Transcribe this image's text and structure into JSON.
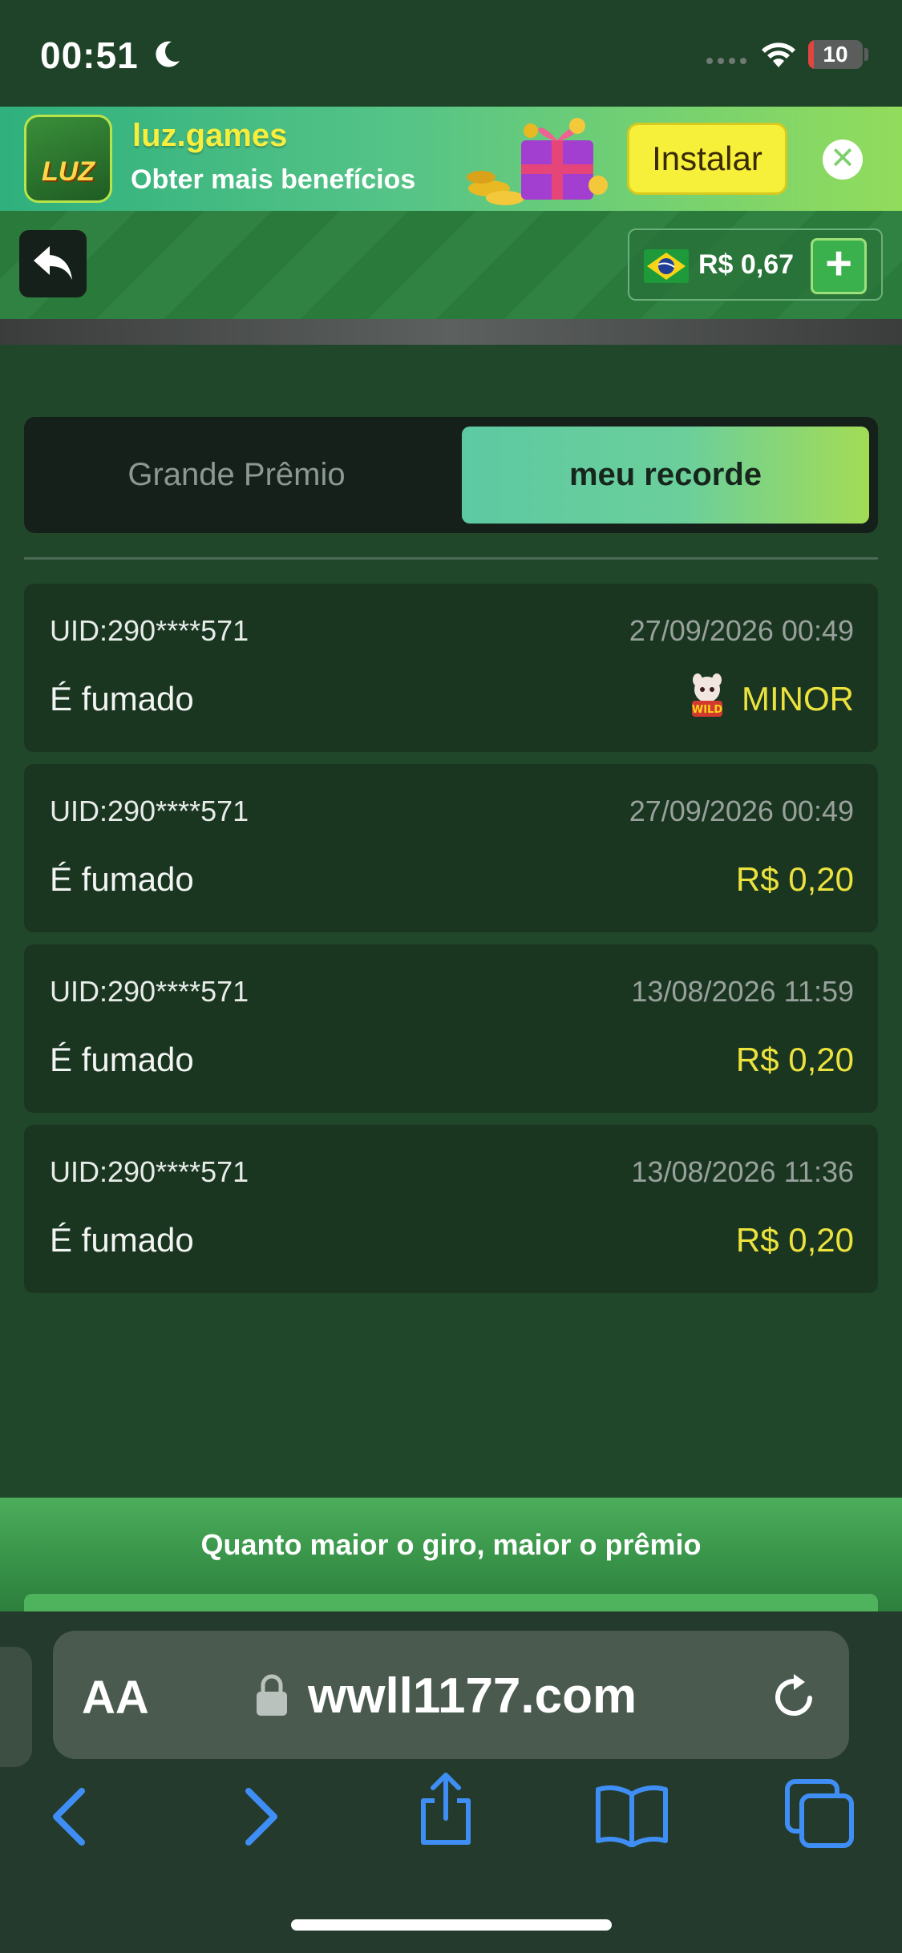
{
  "status_bar": {
    "time": "00:51",
    "battery_level": "10",
    "battery_fraction": 0.1
  },
  "banner": {
    "logo_text": "LUZ",
    "title": "luz.games",
    "subtitle": "Obter mais benefícios",
    "install_label": "Instalar",
    "close_symbol": "✕"
  },
  "header": {
    "balance": "R$ 0,67",
    "add_symbol": "+"
  },
  "tabs": {
    "grand_prize": "Grande Prêmio",
    "my_record": "meu recorde",
    "active": "my_record"
  },
  "records": [
    {
      "uid": "UID:290****571",
      "date": "27/09/2026 00:49",
      "status": "É fumado",
      "prize": "MINOR",
      "prize_icon": "wild-icon"
    },
    {
      "uid": "UID:290****571",
      "date": "27/09/2026 00:49",
      "status": "É fumado",
      "prize": "R$ 0,20"
    },
    {
      "uid": "UID:290****571",
      "date": "13/08/2026 11:59",
      "status": "É fumado",
      "prize": "R$ 0,20"
    },
    {
      "uid": "UID:290****571",
      "date": "13/08/2026 11:36",
      "status": "É fumado",
      "prize": "R$ 0,20"
    }
  ],
  "promo": {
    "text": "Quanto maior o giro, maior o prêmio"
  },
  "browser": {
    "text_size_label": "AA",
    "url": "wwll1177.com",
    "nav_icons": [
      "back-icon",
      "forward-icon",
      "share-icon",
      "bookmarks-icon",
      "tabs-icon"
    ]
  },
  "colors": {
    "background": "#21472a",
    "accent_yellow": "#ece23e",
    "tab_gradient_start": "#5dc9a2",
    "tab_gradient_end": "#a3dc55",
    "ios_blue": "#3f8ef5"
  }
}
